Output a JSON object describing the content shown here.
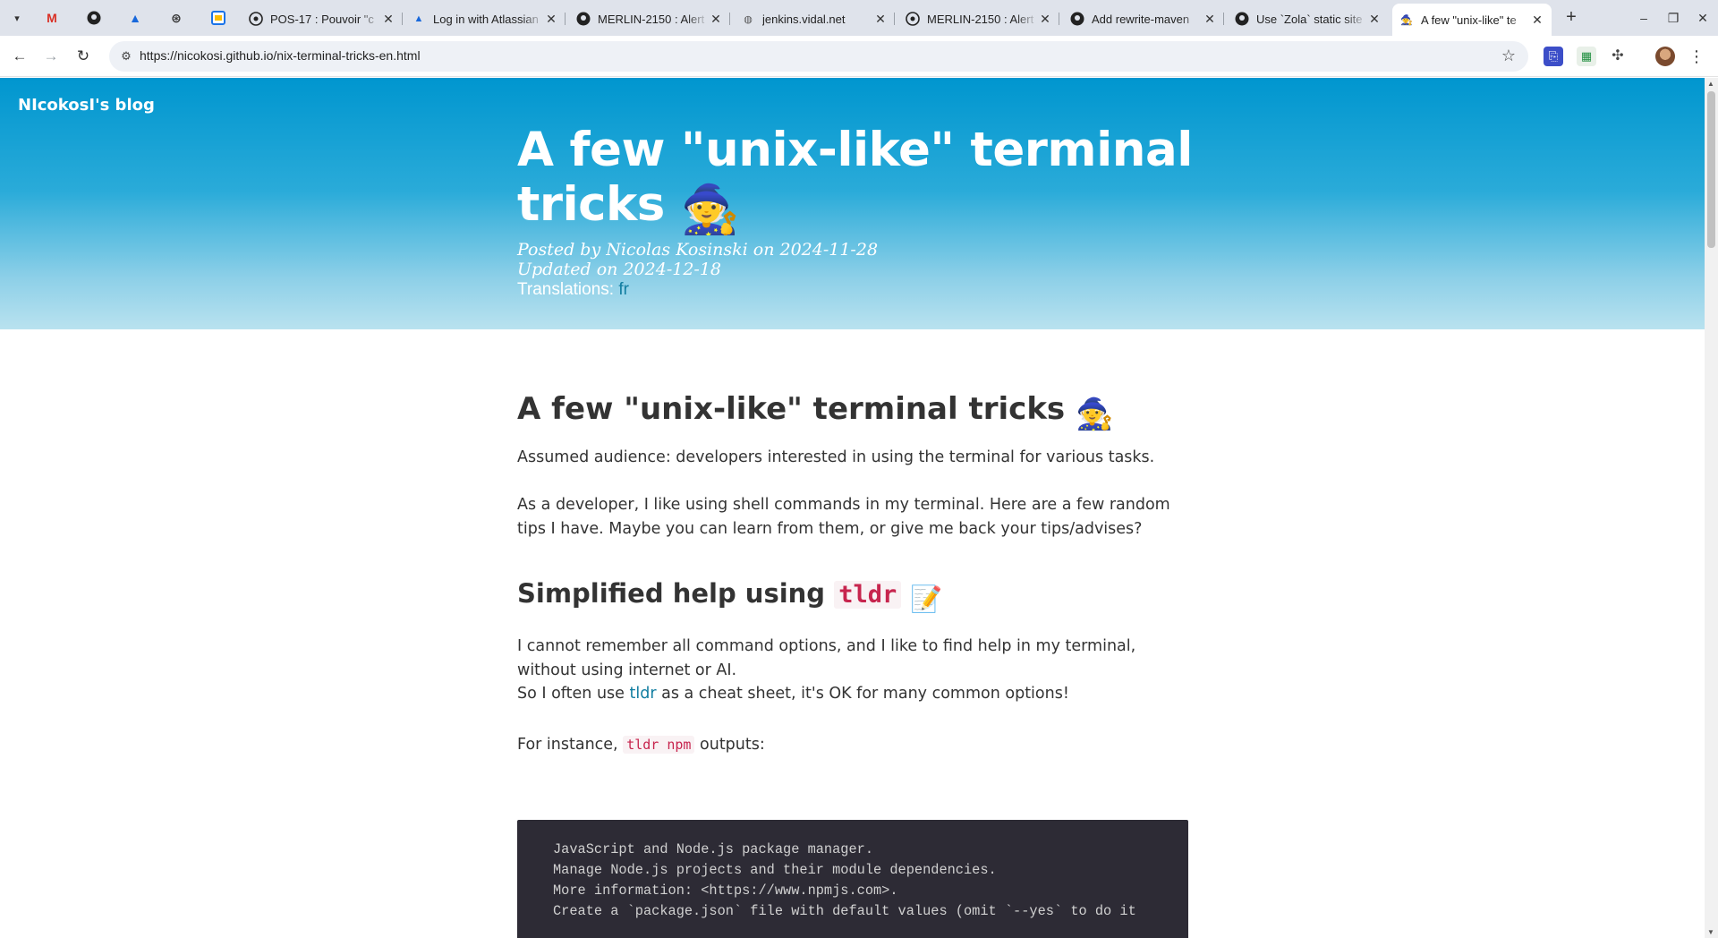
{
  "tabs": [
    {
      "title": "POS-17 : Pouvoir \"c",
      "favicon": "github-icon"
    },
    {
      "title": "Log in with Atlassian",
      "favicon": "atlassian-icon"
    },
    {
      "title": "MERLIN-2150 : Alert",
      "favicon": "github-icon"
    },
    {
      "title": "jenkins.vidal.net",
      "favicon": "globe-icon"
    },
    {
      "title": "MERLIN-2150 : Alert",
      "favicon": "github-icon"
    },
    {
      "title": "Add rewrite-maven",
      "favicon": "github-icon"
    },
    {
      "title": "Use `Zola` static site",
      "favicon": "github-icon"
    },
    {
      "title": "A few \"unix-like\" te",
      "favicon": "wizard-icon",
      "active": true
    }
  ],
  "address_bar": {
    "url": "https://nicokosi.github.io/nix-terminal-tricks-en.html"
  },
  "page": {
    "blog_name": "NIcokosI's blog",
    "hero_title": "A few \"unix-like\" terminal tricks",
    "posted_by": "Posted by Nicolas Kosinski on 2024-11-28",
    "updated_on": "Updated on 2024-12-18",
    "translations_label": "Translations:",
    "translation_link": "fr",
    "h1": "A few \"unix-like\" terminal tricks",
    "audience": "Assumed audience: developers interested in using the terminal for various tasks.",
    "intro": "As a developer, I like using shell commands in my terminal. Here are a few random tips I have. Maybe you can learn from them, or give me back your tips/advises?",
    "h2_prefix": "Simplified help using",
    "h2_code": "tldr",
    "p_remember": "I cannot remember all command options, and I like to find help in my terminal, without using internet or AI.",
    "p_often_prefix": "So I often use",
    "p_often_link": "tldr",
    "p_often_suffix": "as a cheat sheet, it's OK for many common options!",
    "p_instance_prefix": "For instance,",
    "p_instance_code": "tldr npm",
    "p_instance_suffix": "outputs:",
    "code_lines": [
      "JavaScript and Node.js package manager.",
      "Manage Node.js projects and their module dependencies.",
      "More information: <https://www.npmjs.com>.",
      "",
      "Create a `package.json` file with default values (omit `--yes` to do it"
    ],
    "emojis": {
      "wizard": "🧙",
      "memo": "📝"
    }
  },
  "colors": {
    "hero_top": "#0096cf",
    "hero_bottom": "#b9e2ef",
    "link": "#127ea1",
    "inline_code": "#c7254e",
    "code_block_bg": "#2d2b35"
  }
}
